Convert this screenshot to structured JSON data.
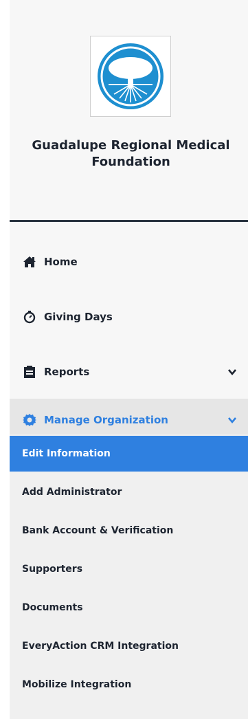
{
  "organization": {
    "name": "Guadalupe Regional Medical Foundation",
    "logo_icon": "tree-logo-icon"
  },
  "colors": {
    "accent": "#2f80e0",
    "logo_blue": "#1e8fd0",
    "divider": "#2a3440"
  },
  "nav": {
    "items": [
      {
        "label": "Home",
        "icon": "home-icon"
      },
      {
        "label": "Giving Days",
        "icon": "stopwatch-icon"
      },
      {
        "label": "Reports",
        "icon": "clipboard-icon",
        "has_chevron": true
      },
      {
        "label": "Manage Organization",
        "icon": "gear-icon",
        "has_chevron": true,
        "expanded": true
      }
    ]
  },
  "submenu": {
    "items": [
      {
        "label": "Edit Information",
        "selected": true
      },
      {
        "label": "Add Administrator"
      },
      {
        "label": "Bank Account & Verification"
      },
      {
        "label": "Supporters"
      },
      {
        "label": "Documents"
      },
      {
        "label": "EveryAction CRM Integration"
      },
      {
        "label": "Mobilize Integration"
      }
    ]
  }
}
